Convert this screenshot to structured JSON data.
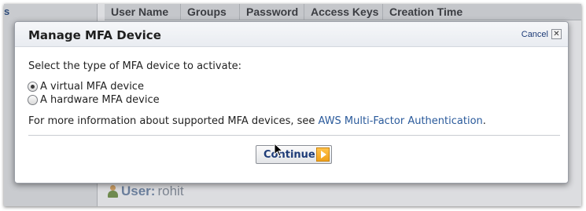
{
  "background": {
    "left_panel_text": "s",
    "table_headers": [
      "User Name",
      "Groups",
      "Password",
      "Access Keys",
      "Creation Time"
    ],
    "user_label": "User:",
    "user_value": "rohit"
  },
  "dialog": {
    "title": "Manage MFA Device",
    "cancel_label": "Cancel",
    "close_symbol": "✕",
    "prompt": "Select the type of MFA device to activate:",
    "options": [
      {
        "label": "A virtual MFA device",
        "selected": true
      },
      {
        "label": "A hardware MFA device",
        "selected": false
      }
    ],
    "info_text": "For more information about supported MFA devices, see ",
    "info_link": "AWS Multi-Factor Authentication",
    "info_suffix": ".",
    "continue_label": "Continue"
  },
  "colors": {
    "link": "#2a5a9b",
    "button_text": "#1e3c78",
    "continue_arrow": "#f0a11a"
  }
}
